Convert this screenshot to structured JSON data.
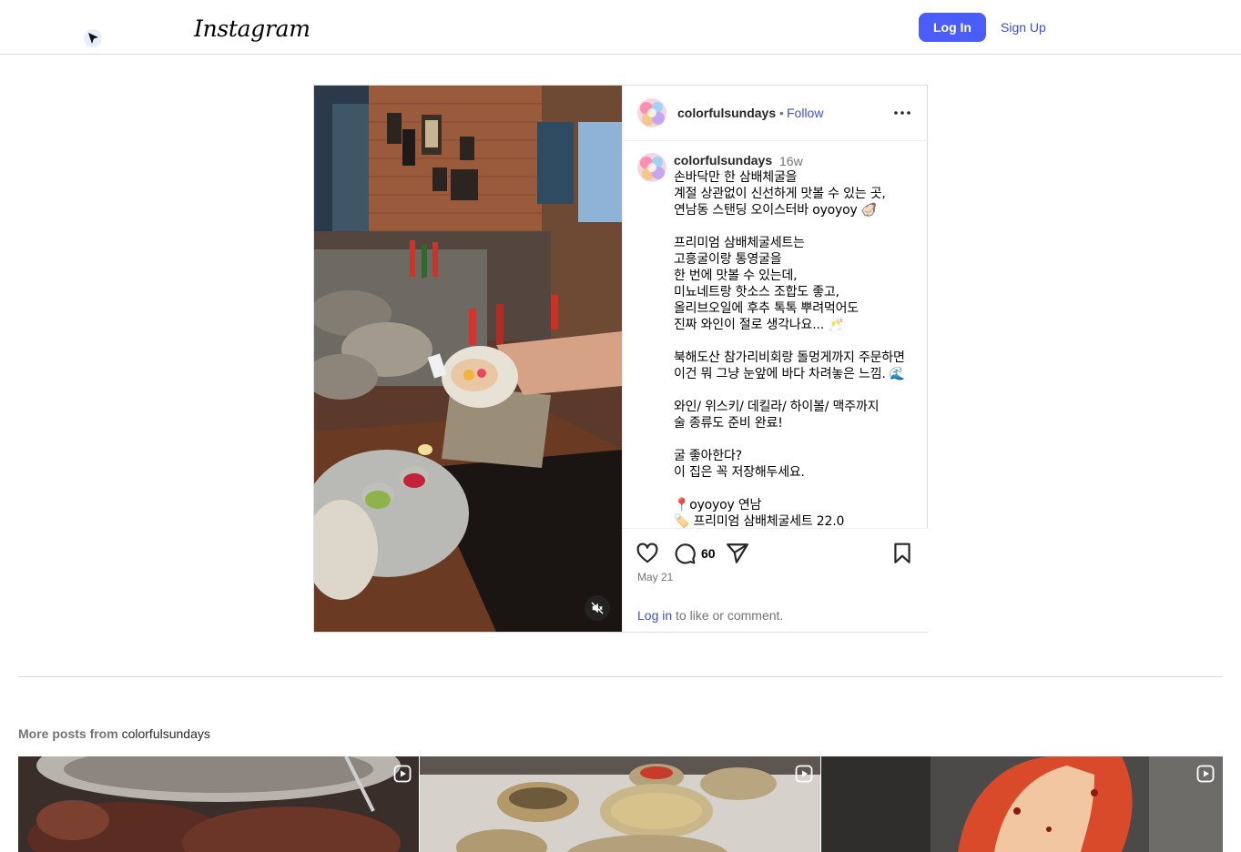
{
  "header": {
    "logo_text": "Instagram",
    "login_label": "Log In",
    "signup_label": "Sign Up",
    "accent_color": "#4a5df9"
  },
  "post": {
    "username": "colorfulsundays",
    "follow_separator": "•",
    "follow_label": "Follow",
    "more_icon": "more-horizontal-icon",
    "media_type": "video",
    "mute_icon": "speaker-muted-icon",
    "caption": {
      "username": "colorfulsundays",
      "time_ago": "16w",
      "text": "손바닥만 한 삼배체굴을\n계절 상관없이 신선하게 맛볼 수 있는 곳,\n연남동 스탠딩 오이스터바 oyoyoy 🦪\n\n프리미엄 삼배체굴세트는\n고흥굴이랑 통영굴을\n한 번에 맛볼 수 있는데,\n미뇨네트랑 핫소스 조합도 좋고,\n올리브오일에 후추 톡톡 뿌려먹어도\n진짜 와인이 절로 생각나요... 🥂\n\n북해도산 참가리비회랑 돌멍게까지 주문하면\n이건 뭐 그냥 눈앞에 바다 차려놓은 느낌. 🌊\n\n와인/ 위스키/ 데킬라/ 하이볼/ 맥주까지\n술 종류도 준비 완료!\n\n굴 좋아한다?\n이 집은 꼭 저장해두세요.\n\n📍oyoyoy 연남\n🏷️ 프리미엄 삼배체굴세트 22.0"
    },
    "comment_count": "60",
    "date": "May 21",
    "login_link": "Log in",
    "login_suffix": " to like or comment."
  },
  "more_posts": {
    "prefix": "More posts from",
    "username": "colorfulsundays",
    "items": [
      {
        "type": "reel",
        "badge_icon": "reel-icon"
      },
      {
        "type": "reel",
        "badge_icon": "reel-icon"
      },
      {
        "type": "reel",
        "badge_icon": "reel-icon"
      }
    ]
  }
}
